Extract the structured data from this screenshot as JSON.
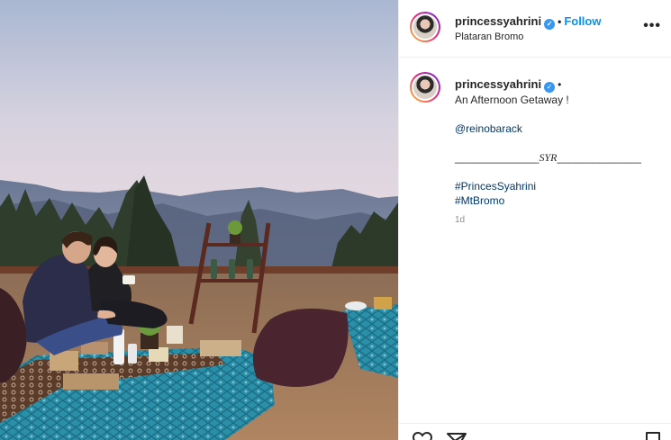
{
  "post": {
    "username": "princessyahrini",
    "follow_label": "Follow",
    "dot": "•",
    "location": "Plataran Bromo",
    "more_label": "•••"
  },
  "caption": {
    "username": "princessyahrini",
    "dot": "•",
    "line1": "An Afternoon Getaway !",
    "mention": "@reinobarack",
    "sig_left": "______________",
    "sig_mid": "SYR",
    "sig_right": "______________",
    "hashtag1": "#PrincesSyahrini",
    "hashtag2": "#MtBromo",
    "time": "1d"
  },
  "icons": {
    "verified": "verified-badge-icon",
    "like": "heart-icon",
    "share": "paper-plane-icon",
    "save": "bookmark-icon"
  },
  "colors": {
    "link": "#00376b",
    "follow": "#0095f6",
    "verified": "#3897f0"
  }
}
